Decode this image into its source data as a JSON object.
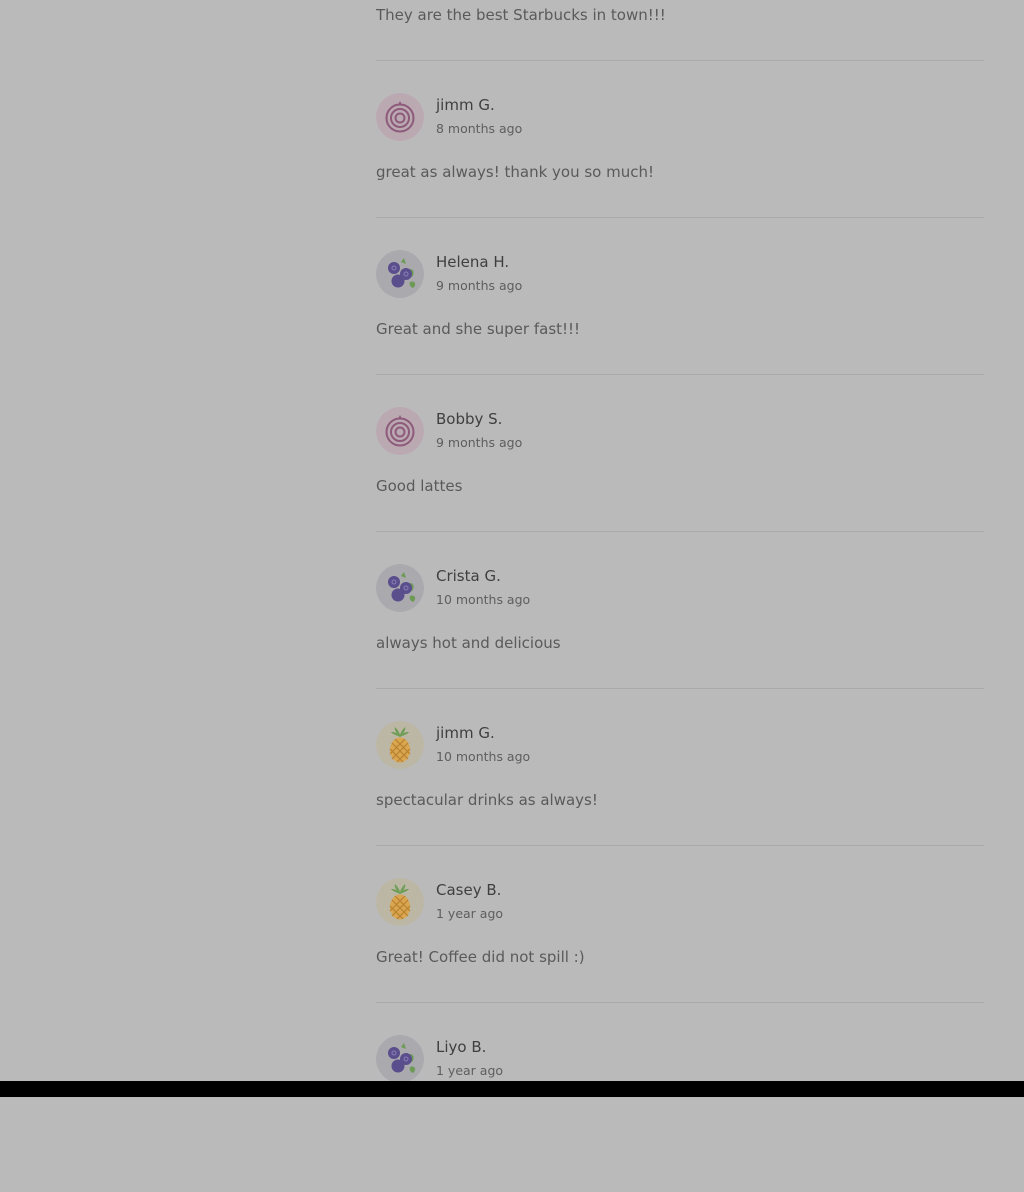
{
  "first_comment": "They are the best Starbucks in town!!!",
  "reviews": [
    {
      "name": "jimm G.",
      "time": "8 months ago",
      "comment": "great as always! thank you so much!",
      "avatar": "onion-icon"
    },
    {
      "name": "Helena H.",
      "time": "9 months ago",
      "comment": "Great and she super fast!!!",
      "avatar": "blueberry-icon"
    },
    {
      "name": "Bobby S.",
      "time": "9 months ago",
      "comment": "Good lattes",
      "avatar": "onion-icon"
    },
    {
      "name": "Crista G.",
      "time": "10 months ago",
      "comment": "always hot and delicious",
      "avatar": "blueberry-icon"
    },
    {
      "name": "jimm G.",
      "time": "10 months ago",
      "comment": "spectacular drinks as always!",
      "avatar": "pineapple-icon"
    },
    {
      "name": "Casey B.",
      "time": "1 year ago",
      "comment": "Great! Coffee did not spill :)",
      "avatar": "pineapple-icon"
    },
    {
      "name": "Liyo B.",
      "time": "1 year ago",
      "comment": "",
      "avatar": "blueberry-icon"
    }
  ],
  "colors": {
    "overlay_background": "#bababa",
    "divider": "#aaaaaa",
    "name_text": "#3f3f3f",
    "comment_text": "#5a5a5a"
  }
}
